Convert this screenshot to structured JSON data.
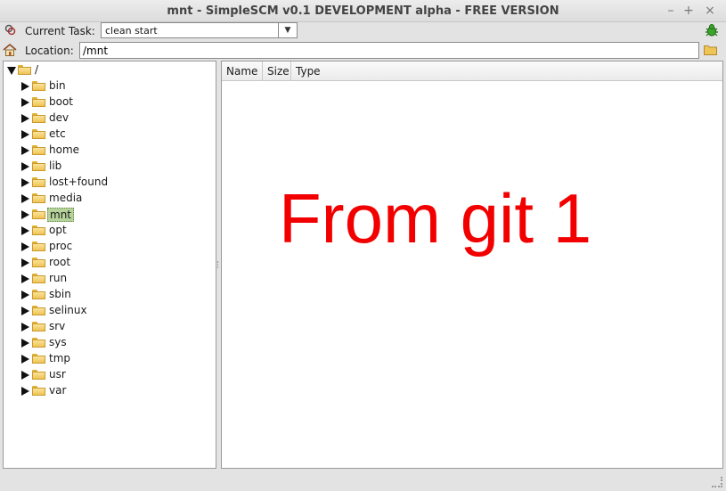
{
  "window": {
    "title": "mnt - SimpleSCM v0.1 DEVELOPMENT alpha - FREE VERSION"
  },
  "toolbar": {
    "task_label": "Current Task:",
    "task_value": "clean start",
    "location_label": "Location:",
    "location_value": "/mnt"
  },
  "tree": {
    "root": "/",
    "items": [
      {
        "label": "bin"
      },
      {
        "label": "boot"
      },
      {
        "label": "dev"
      },
      {
        "label": "etc"
      },
      {
        "label": "home"
      },
      {
        "label": "lib"
      },
      {
        "label": "lost+found"
      },
      {
        "label": "media"
      },
      {
        "label": "mnt",
        "selected": true
      },
      {
        "label": "opt"
      },
      {
        "label": "proc"
      },
      {
        "label": "root"
      },
      {
        "label": "run"
      },
      {
        "label": "sbin"
      },
      {
        "label": "selinux"
      },
      {
        "label": "srv"
      },
      {
        "label": "sys"
      },
      {
        "label": "tmp"
      },
      {
        "label": "usr"
      },
      {
        "label": "var"
      }
    ]
  },
  "filelist": {
    "columns": [
      "Name",
      "Size",
      "Type"
    ]
  },
  "overlay_text": "From git 1",
  "colors": {
    "overlay": "#f20000",
    "selection": "#b5d39a",
    "folder": "#efc457"
  }
}
